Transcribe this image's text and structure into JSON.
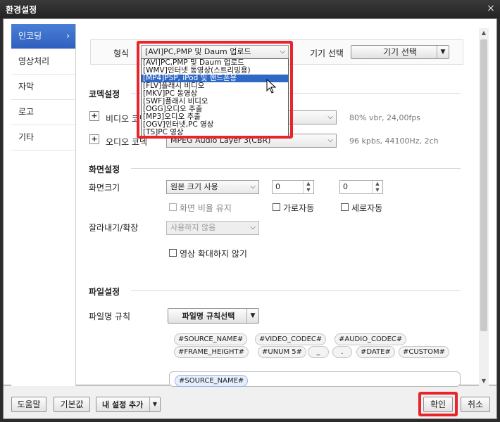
{
  "window": {
    "title": "환경설정",
    "close_icon": "×"
  },
  "sidebar": {
    "items": [
      {
        "label": "인코딩",
        "active": true
      },
      {
        "label": "영상처리",
        "active": false
      },
      {
        "label": "자막",
        "active": false
      },
      {
        "label": "로고",
        "active": false
      },
      {
        "label": "기타",
        "active": false
      }
    ]
  },
  "format": {
    "label": "형식",
    "selected": "[AVI]PC,PMP 및 Daum 업로드",
    "device_label": "기기 선택",
    "device_button": "기기 선택"
  },
  "dropdown_options": [
    {
      "label": "[AVI]PC,PMP 및 Daum 업로드",
      "highlighted": false
    },
    {
      "label": "[WMV]인터넷 동영상(스트리밍용)",
      "highlighted": false
    },
    {
      "label": "[MP4]PSP, iPod 및 핸드폰용",
      "highlighted": true
    },
    {
      "label": "[FLV]플래시 비디오",
      "highlighted": false
    },
    {
      "label": "[MKV]PC 동영상",
      "highlighted": false
    },
    {
      "label": "[SWF]플래시 비디오",
      "highlighted": false
    },
    {
      "label": "[OGG]오디오 추출",
      "highlighted": false
    },
    {
      "label": "[MP3]오디오 추출",
      "highlighted": false
    },
    {
      "label": "[OGV]인터넷,PC 영상",
      "highlighted": false
    },
    {
      "label": "[TS]PC 영상",
      "highlighted": false
    }
  ],
  "codec": {
    "title": "코덱설정",
    "video_label": "비디오 코덱",
    "video_info": "80% vbr, 24,00fps",
    "audio_label": "오디오 코덱",
    "audio_value": "MPEG Audio Layer 3(CBR)",
    "audio_info": "96 kpbs, 44100Hz, 2ch"
  },
  "screen": {
    "title": "화면설정",
    "size_label": "화면크기",
    "size_value": "원본 크기 사용",
    "width_value": "0",
    "height_value": "0",
    "keep_ratio": "화면 비율 유지",
    "horizontal_auto": "가로자동",
    "vertical_auto": "세로자동",
    "crop_label": "잘라내기/확장",
    "crop_value": "사용하지 않음",
    "no_zoom": "영상 확대하지 않기"
  },
  "file": {
    "title": "파일설정",
    "rule_label": "파일명 규칙",
    "rule_button": "파일명 규칙선택",
    "tags_row1": [
      "#SOURCE_NAME#",
      "#VIDEO_CODEC#",
      "#AUDIO_CODEC#"
    ],
    "tags_row2": [
      "#FRAME_HEIGHT#",
      "#UNUM 5#",
      "_",
      ".",
      "#DATE#",
      "#CUSTOM#"
    ],
    "pattern_tag": "#SOURCE_NAME#"
  },
  "footer": {
    "help": "도움말",
    "default": "기본값",
    "my_settings": "내 설정 추가",
    "ok": "확인",
    "cancel": "취소"
  },
  "colors": {
    "highlight_red": "#e8252a",
    "selection_blue": "#3068c6",
    "sidebar_active": "#3a6fcf"
  }
}
